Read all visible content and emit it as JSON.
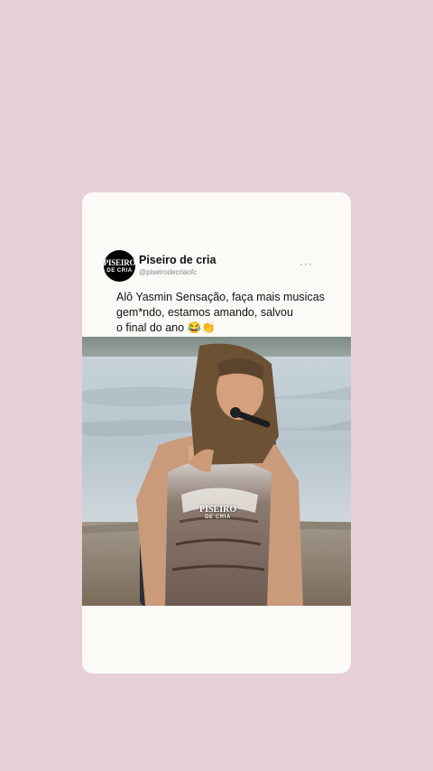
{
  "post": {
    "display_name": "Piseiro de cria",
    "handle": "@piseirodecriaofc",
    "avatar": {
      "line1": "PISEIRO",
      "line2": "DE CRIA"
    },
    "more_label": "···",
    "text": "Alô Yasmin Sensação, faça mais musicas\ngem*ndo, estamos amando, salvou\no final do ano 😂👏",
    "media": {
      "watermark": {
        "line1": "PISEIRO",
        "line2": "DE CRIA"
      }
    }
  },
  "colors": {
    "background": "#e6cfd5",
    "card": "#fbfaf7",
    "text": "#111111",
    "handle": "#8a8a8a"
  }
}
